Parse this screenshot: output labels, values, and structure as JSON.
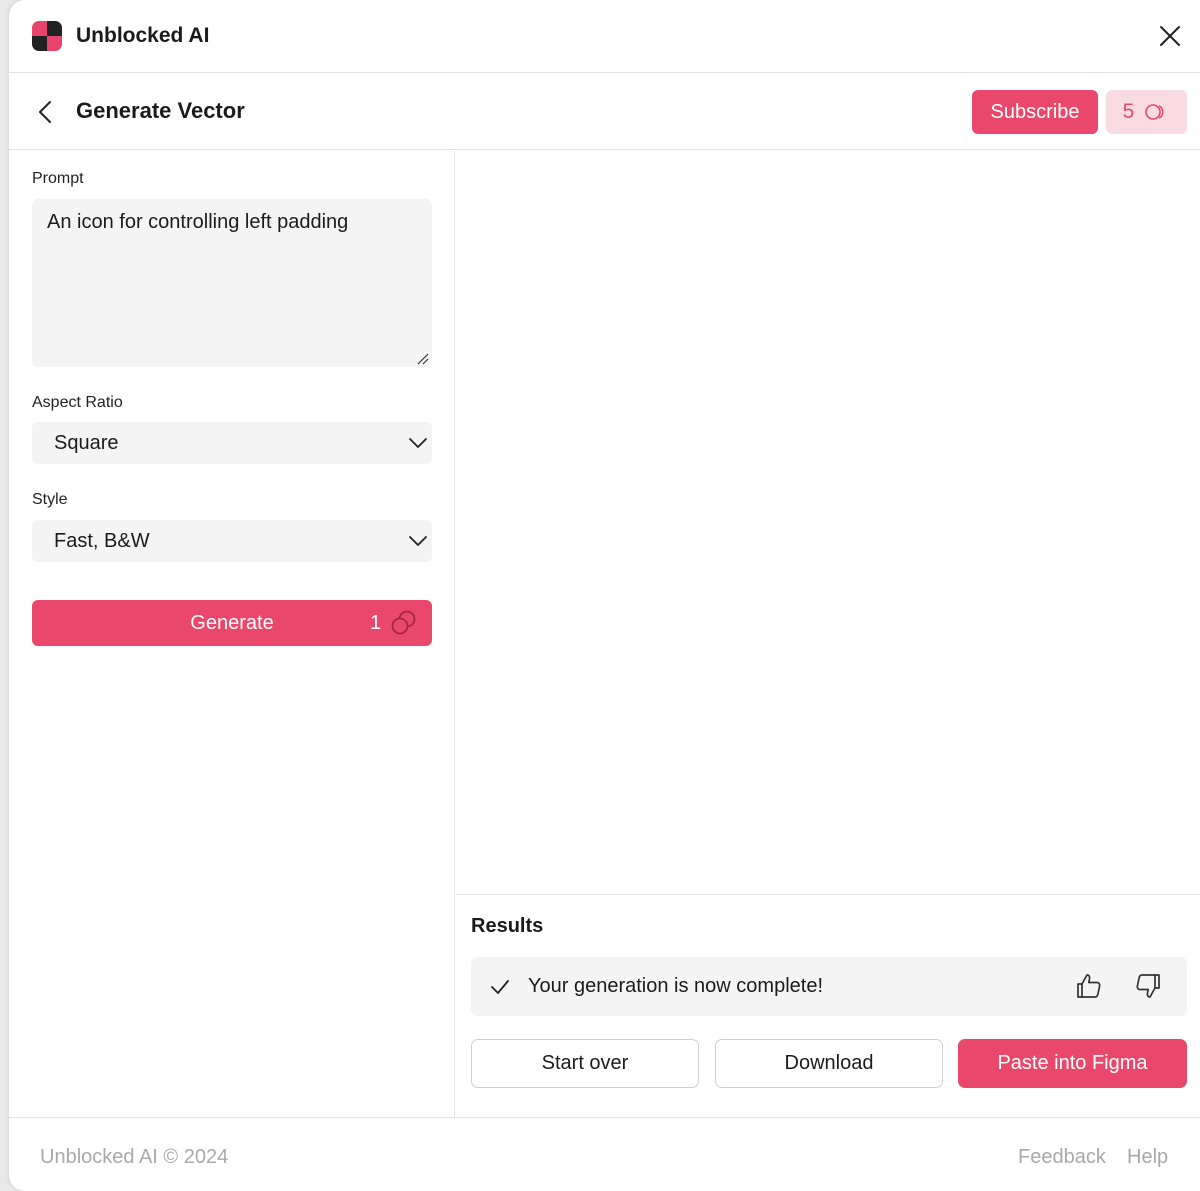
{
  "app": {
    "title": "Unblocked AI"
  },
  "header": {
    "title": "Generate Vector",
    "subscribe_label": "Subscribe",
    "credits": "5"
  },
  "form": {
    "prompt_label": "Prompt",
    "prompt_value": "An icon for controlling left padding",
    "aspect_label": "Aspect Ratio",
    "aspect_value": "Square",
    "style_label": "Style",
    "style_value": "Fast, B&W",
    "generate_label": "Generate",
    "generate_cost": "1"
  },
  "results": {
    "title": "Results",
    "status_message": "Your generation is now complete!",
    "start_over_label": "Start over",
    "download_label": "Download",
    "paste_label": "Paste into Figma"
  },
  "footer": {
    "copyright": "Unblocked AI © 2024",
    "feedback_label": "Feedback",
    "help_label": "Help"
  },
  "colors": {
    "accent": "#e9486c",
    "accent_light": "#fadbe2",
    "field_bg": "#f4f4f4"
  },
  "icons": [
    "app-logo",
    "close-icon",
    "back-arrow-icon",
    "credits-coin-icon",
    "chevron-down-icon",
    "check-icon",
    "thumbs-up-icon",
    "thumbs-down-icon",
    "resize-grip-icon"
  ]
}
